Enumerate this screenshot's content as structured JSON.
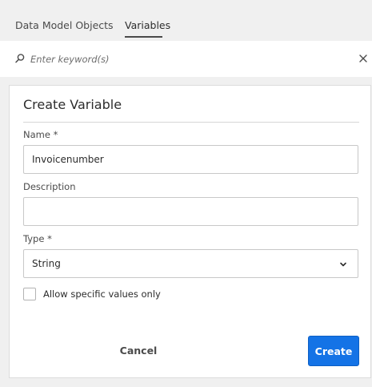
{
  "tabs": [
    {
      "label": "Data Model Objects"
    },
    {
      "label": "Variables"
    }
  ],
  "search": {
    "placeholder": "Enter keyword(s)",
    "search_icon": "search-icon",
    "clear_icon": "close-icon"
  },
  "form": {
    "title": "Create Variable",
    "name_label": "Name *",
    "name_value": "Invoicenumber",
    "description_label": "Description",
    "description_value": "",
    "type_label": "Type *",
    "type_value": "String",
    "type_icon": "chevron-down-icon",
    "allow_specific_label": "Allow specific values only",
    "allow_specific_checked": false,
    "cancel_label": "Cancel",
    "create_label": "Create"
  },
  "colors": {
    "accent": "#1473e6",
    "background": "#f0f0f0"
  }
}
